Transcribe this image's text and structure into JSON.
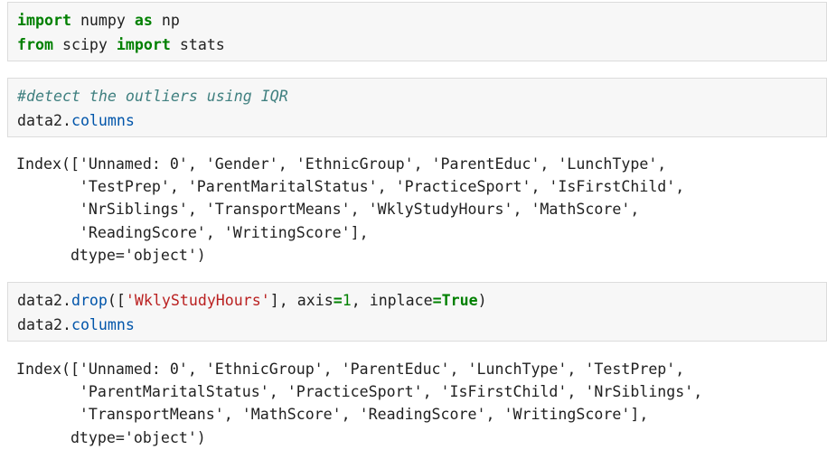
{
  "cells": [
    {
      "type": "code",
      "lines": [
        {
          "kw1": "import",
          "t1": " numpy ",
          "kw2": "as",
          "t2": " np"
        },
        {
          "kw1": "from",
          "t1": " scipy ",
          "kw2": "import",
          "t2": " stats"
        }
      ]
    },
    {
      "type": "code",
      "comment": "#detect the outliers using IQR",
      "obj": "data2",
      "attr": "columns"
    },
    {
      "type": "output",
      "lines": [
        "Index(['Unnamed: 0', 'Gender', 'EthnicGroup', 'ParentEduc', 'LunchType',",
        "       'TestPrep', 'ParentMaritalStatus', 'PracticeSport', 'IsFirstChild',",
        "       'NrSiblings', 'TransportMeans', 'WklyStudyHours', 'MathScore',",
        "       'ReadingScore', 'WritingScore'],",
        "      dtype='object')"
      ]
    },
    {
      "type": "code",
      "obj": "data2",
      "method": "drop",
      "bracket_open": "([",
      "string": "'WklyStudyHours'",
      "bracket_close": "], ",
      "kwarg1": "axis",
      "eq1": "=",
      "num": "1",
      "sep": ", ",
      "kwarg2": "inplace",
      "eq2": "=",
      "bool": "True",
      "end": ")",
      "line2_obj": "data2",
      "line2_attr": "columns"
    },
    {
      "type": "output",
      "lines": [
        "Index(['Unnamed: 0', 'EthnicGroup', 'ParentEduc', 'LunchType', 'TestPrep',",
        "       'ParentMaritalStatus', 'PracticeSport', 'IsFirstChild', 'NrSiblings',",
        "       'TransportMeans', 'MathScore', 'ReadingScore', 'WritingScore'],",
        "      dtype='object')"
      ]
    }
  ]
}
